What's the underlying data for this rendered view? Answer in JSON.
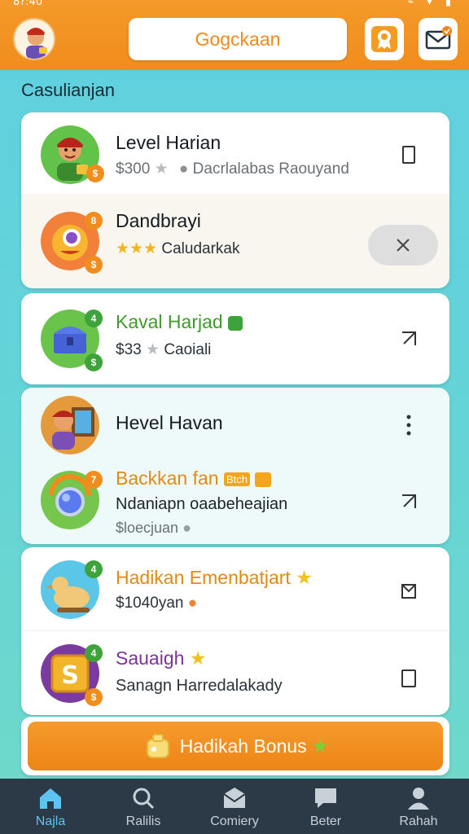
{
  "status": {
    "time": "8?:40",
    "icons": "⌁ ▾ ▮"
  },
  "header": {
    "title": "Gogckaan"
  },
  "section": {
    "label": "Casulianjan"
  },
  "cards": [
    {
      "rows": [
        {
          "title": "Level Harian",
          "sub_prefix": "$300",
          "sub_suffix": "Dacrlalabas Raouyand",
          "action": "square-icon"
        },
        {
          "title": "Dandbrayi",
          "sub_suffix": "Caludarkak",
          "action": "close-icon"
        }
      ]
    },
    {
      "rows": [
        {
          "title": "Kaval Harjad",
          "sub_prefix": "$33",
          "sub_suffix": "Caoiali",
          "action": "external-icon"
        }
      ]
    },
    {
      "rows": [
        {
          "title": "Hevel Havan",
          "action": "more-icon"
        },
        {
          "title": "Backkan fan",
          "tag": "Btch",
          "sub": "Ndaniapn oaabeheajian",
          "sub2": "$loecjuan",
          "action": "external-icon"
        }
      ]
    },
    {
      "rows": [
        {
          "title": "Hadikan Emenbatjart",
          "sub": "$1040yan",
          "action": "checkbox-icon"
        },
        {
          "title": "Sauaigh",
          "sub": "Sanagn Harredalakady",
          "action": "square-icon"
        }
      ]
    }
  ],
  "bonus": {
    "label": "Hadikah Bonus"
  },
  "nav": [
    {
      "label": "Najla",
      "icon": "home-icon",
      "active": true
    },
    {
      "label": "Ralilis",
      "icon": "search-icon",
      "active": false
    },
    {
      "label": "Comiery",
      "icon": "mail-icon",
      "active": false
    },
    {
      "label": "Beter",
      "icon": "chat-icon",
      "active": false
    },
    {
      "label": "Rahah",
      "icon": "profile-icon",
      "active": false
    }
  ],
  "colors": {
    "accent": "#ef8c1c",
    "title_orange": "#e38a12",
    "title_green": "#3f9a2a",
    "title_purple": "#7d3199",
    "nav_bg": "#2c3a48",
    "nav_active": "#5ec3f0"
  }
}
